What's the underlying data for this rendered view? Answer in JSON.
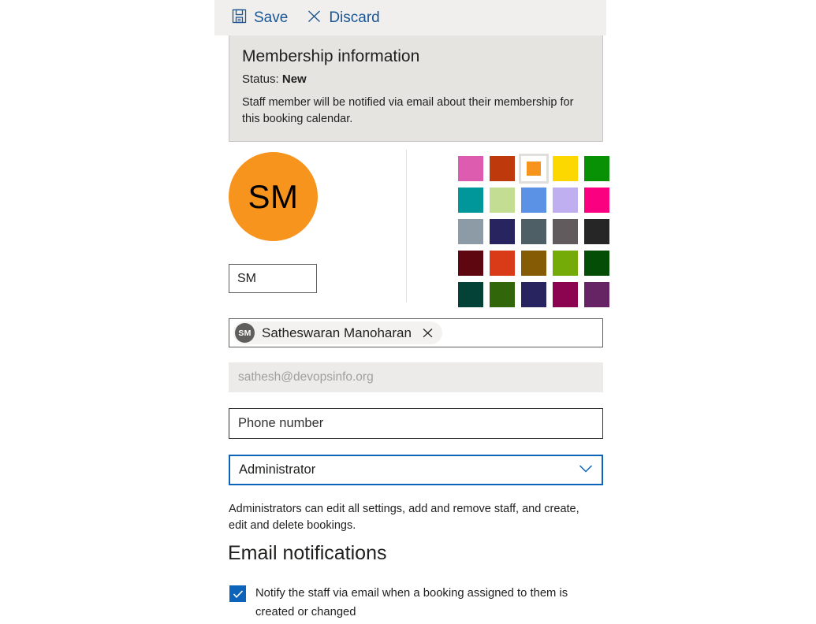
{
  "toolbar": {
    "save_label": "Save",
    "discard_label": "Discard"
  },
  "membership": {
    "title": "Membership information",
    "status_label": "Status:",
    "status_value": "New",
    "description": "Staff member will be notified via email about their membership for this booking calendar."
  },
  "avatar": {
    "initials": "SM",
    "color": "#F7941E",
    "initials_input_value": "SM"
  },
  "palette": {
    "selected_index": 2,
    "colors": [
      "#DD5CB0",
      "#BE3A0C",
      "#F7941E",
      "#FDD800",
      "#089105",
      "#00979A",
      "#C3DE92",
      "#5B92E5",
      "#BFAEF0",
      "#FA0080",
      "#8C9BA5",
      "#27245F",
      "#4F5F66",
      "#615B5D",
      "#262626",
      "#5E0711",
      "#D93B18",
      "#855B05",
      "#74AB08",
      "#044D06",
      "#044238",
      "#31660A",
      "#27245F",
      "#8C0450",
      "#662465"
    ]
  },
  "person": {
    "chip_initials": "SM",
    "chip_name": "Satheswaran Manoharan"
  },
  "email": {
    "value": "sathesh@devopsinfo.org"
  },
  "phone": {
    "placeholder": "Phone number",
    "value": ""
  },
  "role": {
    "value": "Administrator",
    "help_text": "Administrators can edit all settings, add and remove staff, and create, edit and delete bookings."
  },
  "notifications": {
    "section_title": "Email notifications",
    "checkbox_label": "Notify the staff via email when a booking assigned to them is created or changed",
    "checked": true
  },
  "colors": {
    "accent": "#0b63ba",
    "toolbar_link": "#1a5693",
    "panel_bg": "#e6e4e1"
  }
}
